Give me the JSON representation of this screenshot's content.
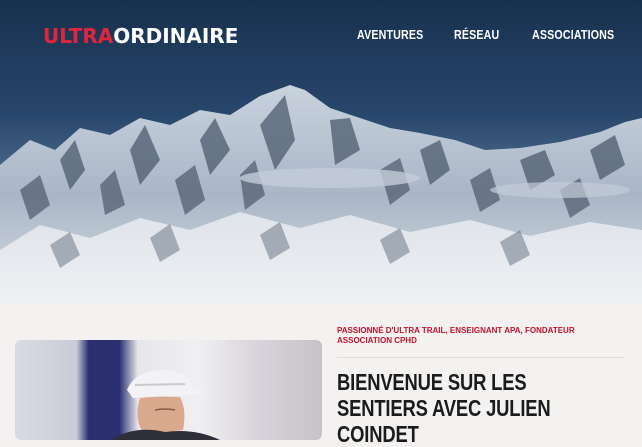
{
  "header": {
    "logo_part1": "ULTRA",
    "logo_part2": "ORDINAIRE",
    "nav": [
      "AVENTURES",
      "RÉSEAU",
      "ASSOCIATIONS"
    ]
  },
  "hero": {
    "image": "snowy-mountain-range-photo"
  },
  "intro": {
    "eyebrow": "PASSIONNÉ D'ULTRA TRAIL, ENSEIGNANT APA, FONDATEUR ASSOCIATION CPHD",
    "title": "BIENVENUE SUR LES SENTIERS AVEC JULIEN COINDET",
    "photo": "runner-portrait-photo"
  },
  "colors": {
    "brand_red": "#e0253c",
    "eyebrow_red": "#c0112b",
    "title": "#1b1b1b",
    "background": "#f4f2f1"
  }
}
